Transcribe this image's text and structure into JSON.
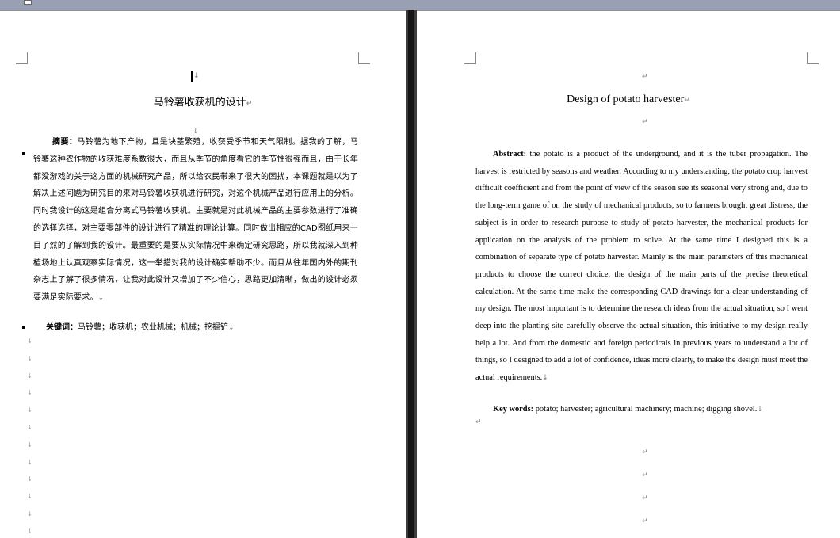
{
  "left_page": {
    "title": "马铃薯收获机的设计",
    "abstract_label": "摘要：",
    "abstract_text": "马铃薯为地下产物，且是块茎繁殖，收获受季节和天气限制。据我的了解，马铃薯这种农作物的收获难度系数很大，而且从季节的角度看它的季节性很强而且，由于长年都没游戏的关于这方面的机械研究产品，所以给农民带来了很大的困扰，本课题就是以为了解决上述问题为研究目的来对马铃薯收获机进行研究，对这个机械产品进行应用上的分析。同时我设计的这是组合分离式马铃薯收获机。主要就是对此机械产品的主要参数进行了准确的选择选择，对主要零部件的设计进行了精准的理论计算。同时做出相应的CAD图纸用来一目了然的了解到我的设计。最重要的是要从实际情况中来确定研究思路，所以我就深入到种植场地上认真观察实际情况，这一举措对我的设计确实帮助不少。而且从往年国内外的期刊杂志上了解了很多情况，让我对此设计又增加了不少信心，思路更加清晰，做出的设计必须要满足实际要求。",
    "keywords_label": "关键词：",
    "keywords_text": "马铃薯；收获机；农业机械；机械；挖掘铲"
  },
  "right_page": {
    "title": "Design of potato harvester",
    "abstract_label": "Abstract:",
    "abstract_text": "the potato is a product of the underground, and it is the tuber propagation. The harvest is restricted by seasons and weather. According to my understanding, the potato crop harvest difficult coefficient and from the point of view of the season see its seasonal very strong and, due to the long-term game of on the study of mechanical products, so to farmers brought great distress, the subject is in order to research purpose to study of potato harvester, the mechanical products for application on the analysis of the problem to solve. At the same time I designed this is a combination of separate type of potato harvester. Mainly is the main parameters of this mechanical products to choose the correct choice, the design of the main parts of the precise theoretical calculation. At the same time make the corresponding CAD drawings for a clear understanding of my design. The most important is to determine the research ideas from the actual situation, so I went deep into the planting site carefully observe the actual situation, this initiative to my design really help a lot. And from the domestic and foreign periodicals in previous years to understand a lot of things, so I designed to add a lot of confidence, ideas more clearly, to make the design must meet the actual requirements.",
    "keywords_label": "Key words:",
    "keywords_text": "potato; harvester; agricultural machinery; machine; digging shovel."
  },
  "marks": {
    "return": "↵",
    "para_end": "↓"
  }
}
